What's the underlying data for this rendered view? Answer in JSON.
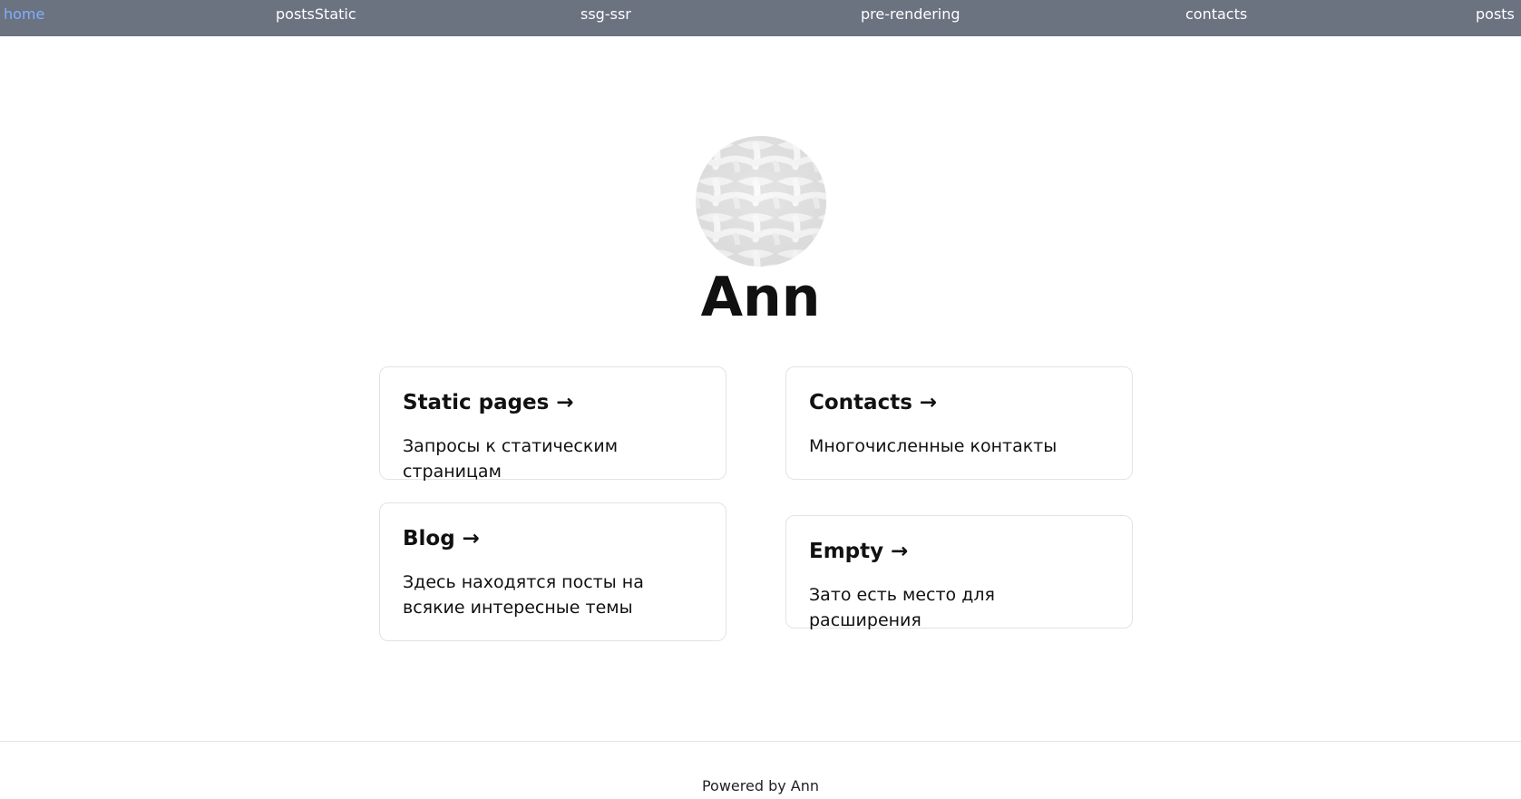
{
  "nav": {
    "items": [
      {
        "label": "home",
        "active": true
      },
      {
        "label": "postsStatic",
        "active": false
      },
      {
        "label": "ssg-ssr",
        "active": false
      },
      {
        "label": "pre-rendering",
        "active": false
      },
      {
        "label": "contacts",
        "active": false
      },
      {
        "label": "posts",
        "active": false
      }
    ]
  },
  "hero": {
    "avatar_icon": "woven-pattern-avatar",
    "name": "Ann"
  },
  "cards": [
    {
      "title": "Static pages →",
      "description": "Запросы к статическим страницам"
    },
    {
      "title": "Contacts →",
      "description": "Многочисленные контакты"
    },
    {
      "title": "Blog →",
      "description": "Здесь находятся посты на всякие интересные темы"
    },
    {
      "title": "Empty →",
      "description": "Зато есть место для расширения"
    }
  ],
  "footer": {
    "text": "Powered by Ann"
  },
  "colors": {
    "nav_background": "#6b7280",
    "nav_text": "#ffffff",
    "nav_active": "#7fb0ff",
    "card_border": "#e3e3e3"
  }
}
